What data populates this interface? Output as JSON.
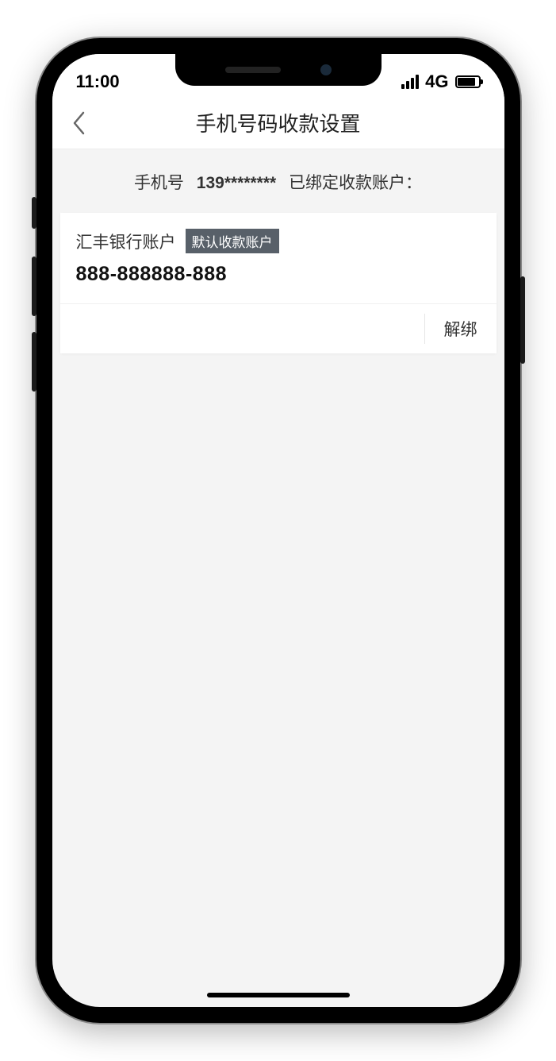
{
  "statusbar": {
    "time": "11:00",
    "network": "4G"
  },
  "nav": {
    "title": "手机号码收款设置"
  },
  "info": {
    "label_prefix": "手机号",
    "phone": "139********",
    "label_suffix": "已绑定收款账户："
  },
  "account_card": {
    "bank_name": "汇丰银行账户",
    "badge": "默认收款账户",
    "account_number": "888-888888-888",
    "unbind_label": "解绑"
  }
}
